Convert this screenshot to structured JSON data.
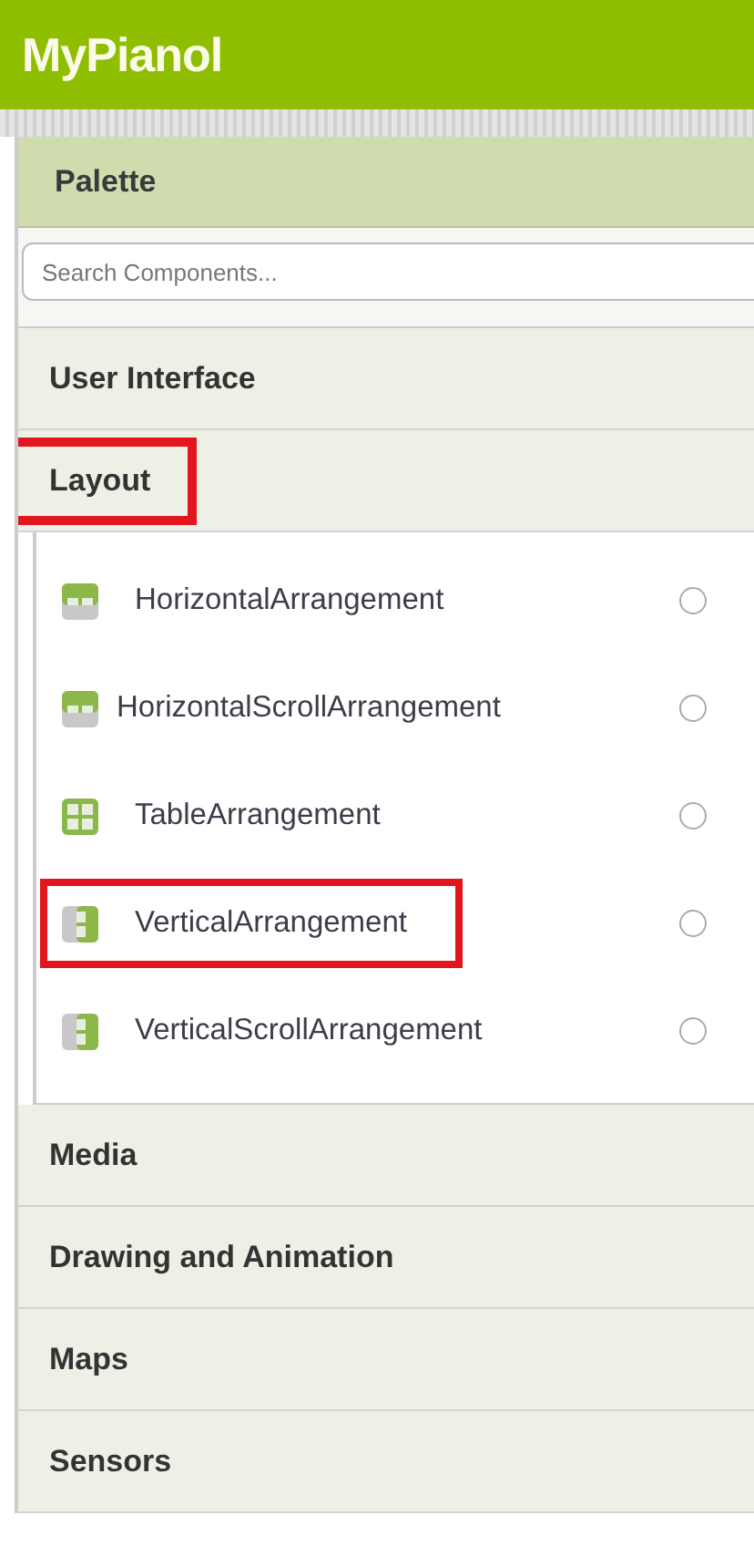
{
  "app_bar": {
    "title": "MyPianol"
  },
  "palette": {
    "title": "Palette",
    "search": {
      "placeholder": "Search Components..."
    },
    "categories": [
      {
        "label": "User Interface",
        "highlighted": false
      },
      {
        "label": "Layout",
        "highlighted": true,
        "items": [
          {
            "label": "HorizontalArrangement",
            "kind": "horizontal",
            "highlighted": false
          },
          {
            "label": "HorizontalScrollArrangement",
            "kind": "horizontal",
            "highlighted": false
          },
          {
            "label": "TableArrangement",
            "kind": "table",
            "highlighted": false
          },
          {
            "label": "VerticalArrangement",
            "kind": "vertical",
            "highlighted": true
          },
          {
            "label": "VerticalScrollArrangement",
            "kind": "vertical",
            "highlighted": false
          }
        ]
      },
      {
        "label": "Media",
        "highlighted": false
      },
      {
        "label": "Drawing and Animation",
        "highlighted": false
      },
      {
        "label": "Maps",
        "highlighted": false
      },
      {
        "label": "Sensors",
        "highlighted": false
      }
    ]
  }
}
